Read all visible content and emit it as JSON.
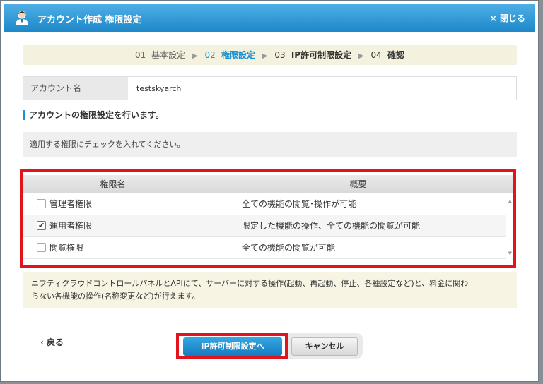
{
  "dialog": {
    "title": "アカウント作成  権限設定",
    "close_label": "× 閉じる"
  },
  "steps": [
    {
      "num": "01",
      "label": "基本設定",
      "state": "done"
    },
    {
      "num": "02",
      "label": "権限設定",
      "state": "active"
    },
    {
      "num": "03",
      "label": "IP許可制限設定",
      "state": "current"
    },
    {
      "num": "04",
      "label": "確認",
      "state": "current"
    }
  ],
  "account": {
    "label": "アカウント名",
    "value": "testskyarch"
  },
  "section_heading": "アカウントの権限設定を行います。",
  "hint": "適用する権限にチェックを入れてください。",
  "table": {
    "headers": [
      "権限名",
      "概要"
    ],
    "rows": [
      {
        "name": "管理者権限",
        "desc": "全ての機能の閲覧･操作が可能",
        "checked": false
      },
      {
        "name": "運用者権限",
        "desc": "限定した機能の操作、全ての機能の閲覧が可能",
        "checked": true
      },
      {
        "name": "閲覧権限",
        "desc": "全ての機能の閲覧が可能",
        "checked": false
      }
    ]
  },
  "note": {
    "line1": "ニフティクラウドコントロールパネルとAPIにて、サーバーに対する操作(起動、再起動、停止、各種設定など)と、料金に関わ",
    "line2": "らない各機能の操作(名称変更など)が行えます。"
  },
  "footer": {
    "back_label": "戻る",
    "next_label": "IP許可制限設定へ",
    "cancel_label": "キャンセル"
  },
  "colors": {
    "accent": "#1a8fd1",
    "highlight": "#e0141c"
  }
}
